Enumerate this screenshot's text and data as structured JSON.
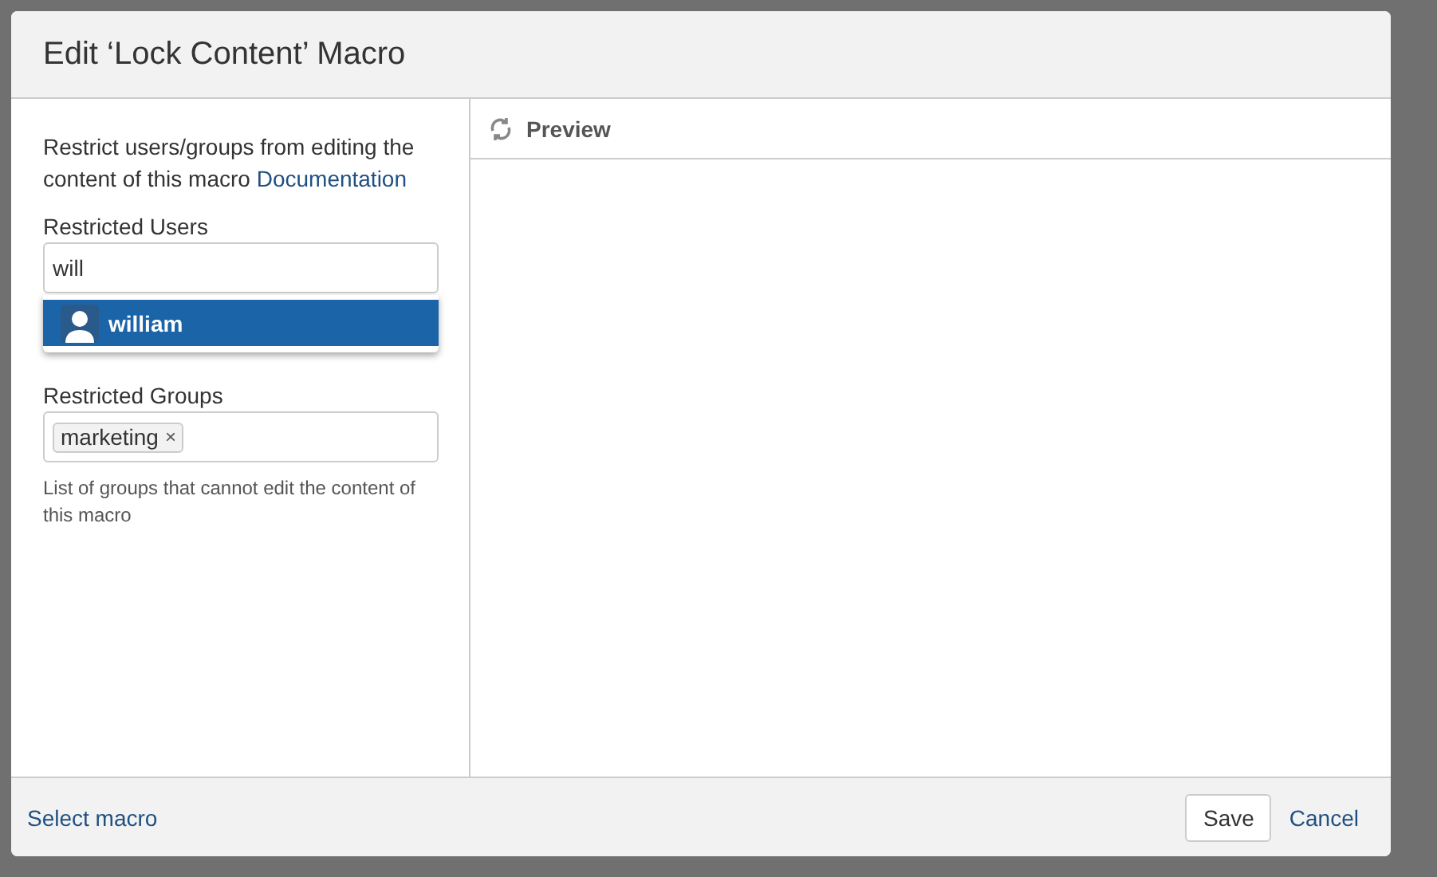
{
  "dialog": {
    "title": "Edit ‘Lock Content’ Macro"
  },
  "form": {
    "intro": "Restrict users/groups from editing the content of this macro",
    "doc_link": "Documentation",
    "users": {
      "label": "Restricted Users",
      "value": "will",
      "suggestions": [
        {
          "name": "william",
          "selected": true
        }
      ]
    },
    "groups": {
      "label": "Restricted Groups",
      "tags": [
        {
          "name": "marketing",
          "remove": "×"
        }
      ],
      "help": "List of groups that cannot edit the content of this macro"
    }
  },
  "preview": {
    "title": "Preview"
  },
  "footer": {
    "link": "Select macro",
    "buttons": [
      {
        "label": "Save",
        "kind": "button"
      },
      {
        "label": "Cancel",
        "kind": "link"
      }
    ]
  }
}
